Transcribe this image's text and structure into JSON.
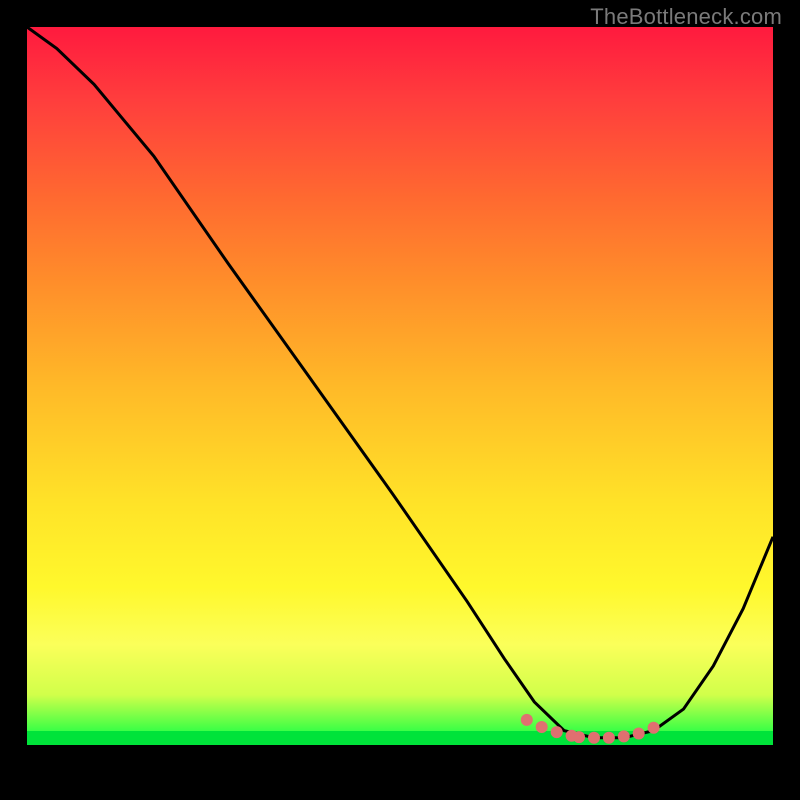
{
  "watermark": "TheBottleneck.com",
  "colors": {
    "background": "#000000",
    "gradient_top": "#ff1a3e",
    "gradient_bottom": "#00ff44",
    "curve": "#000000",
    "marker": "#e07070",
    "watermark": "#7a7a7a"
  },
  "chart_data": {
    "type": "line",
    "title": "",
    "xlabel": "",
    "ylabel": "",
    "xlim": [
      0,
      100
    ],
    "ylim": [
      0,
      100
    ],
    "grid": false,
    "legend": "none",
    "series": [
      {
        "name": "bottleneck-curve",
        "x": [
          0,
          4,
          9,
          17,
          27,
          38,
          49,
          59,
          64,
          68,
          72,
          76,
          80,
          84,
          88,
          92,
          96,
          100
        ],
        "y": [
          100,
          97,
          92,
          82,
          67,
          51,
          35,
          20,
          12,
          6,
          2,
          1,
          1,
          2,
          5,
          11,
          19,
          29
        ]
      }
    ],
    "markers": {
      "name": "selected-range",
      "x": [
        67,
        69,
        71,
        73,
        74,
        76,
        78,
        80,
        82,
        84
      ],
      "y": [
        3.5,
        2.5,
        1.8,
        1.3,
        1.1,
        1.0,
        1.0,
        1.2,
        1.6,
        2.4
      ]
    },
    "background_gradient": [
      "#ff1a3e",
      "#ff6a30",
      "#ffb928",
      "#fff82c",
      "#00ff44"
    ]
  }
}
